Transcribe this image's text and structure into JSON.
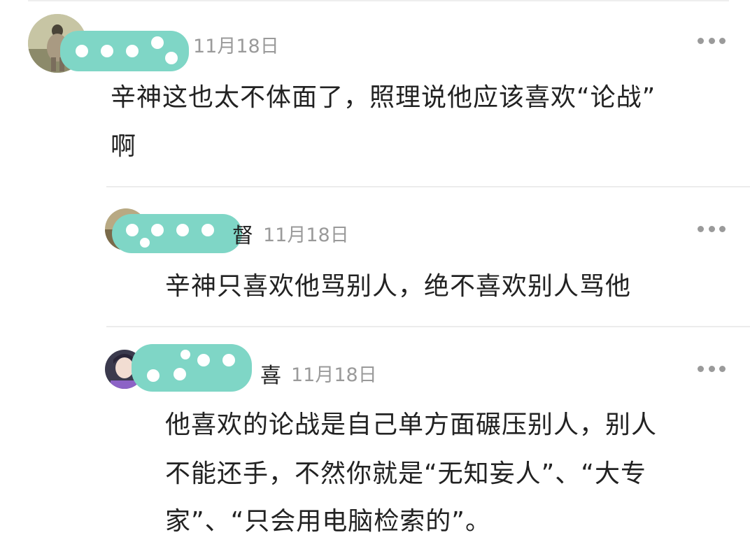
{
  "comments": [
    {
      "name_tail": "",
      "date": "11月18日",
      "text_line1": "辛神这也太不体面了，照理说他应该喜欢“论战”",
      "text_line2": "啊"
    },
    {
      "name_tail": "督",
      "date": "11月18日",
      "text_line1": "辛神只喜欢他骂别人，绝不喜欢别人骂他"
    },
    {
      "name_tail": "喜",
      "date": "11月18日",
      "text_line1": "他喜欢的论战是自己单方面碾压别人，别人",
      "text_line2": "不能还手，不然你就是“无知妄人”、“大专",
      "text_line3": "家”、“只会用电脑检索的”。"
    }
  ],
  "colors": {
    "mask": "#7fd6c6",
    "date": "#9a9a9a",
    "text": "#222222",
    "divider": "#ececec"
  },
  "icons": [
    "more-options-icon",
    "avatar"
  ]
}
